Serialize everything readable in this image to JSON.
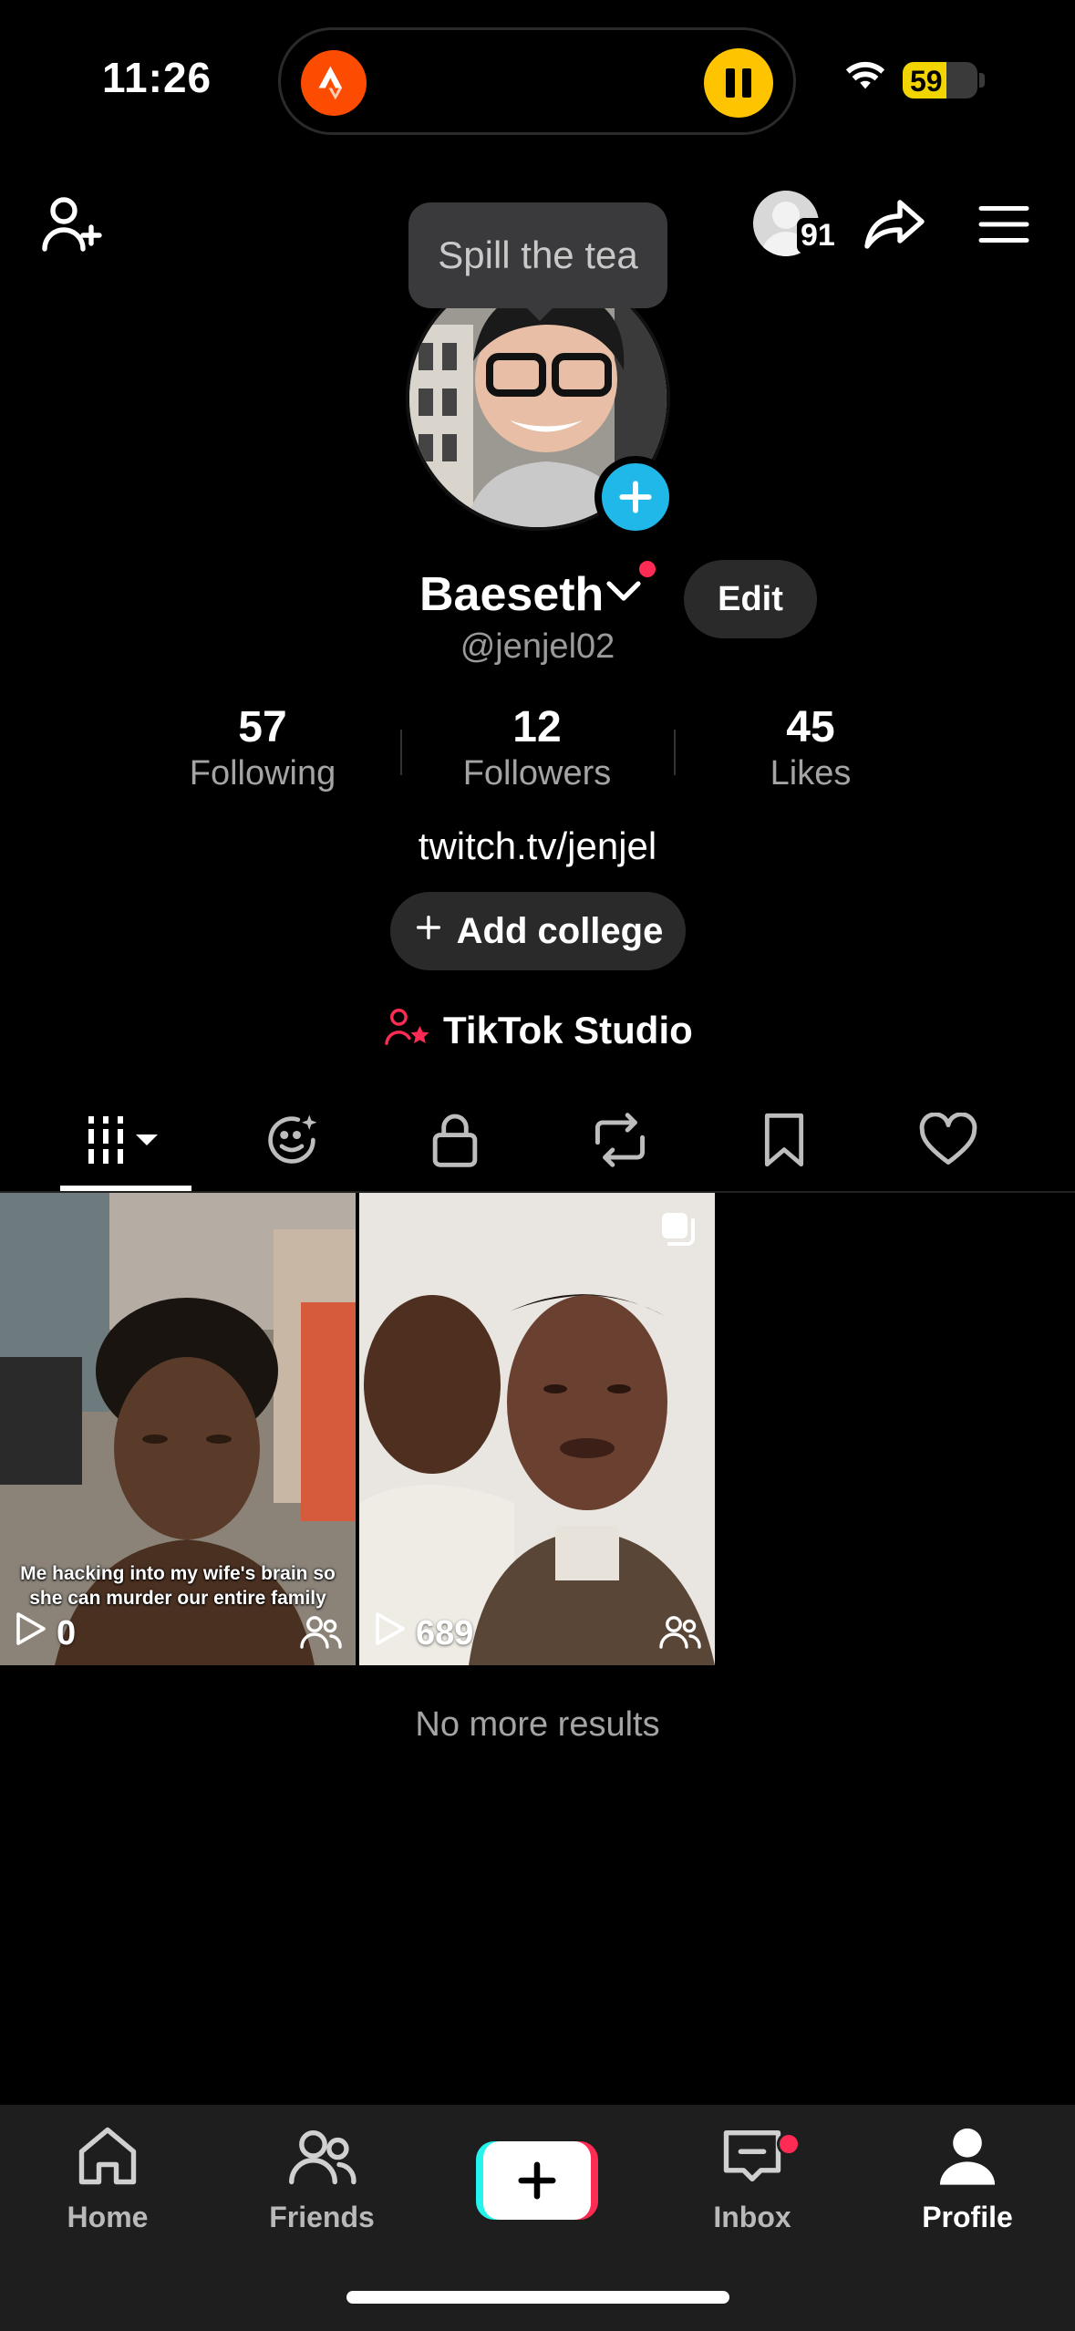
{
  "status_bar": {
    "time": "11:26",
    "battery": "59",
    "battery_level_percent": 59,
    "live_activity_app_icon": "strava-icon",
    "live_activity_control_icon": "pause-icon"
  },
  "header": {
    "add_friend_icon": "person-add-icon",
    "visitors_count": "91",
    "share_icon": "share-icon",
    "menu_icon": "hamburger-menu-icon",
    "tooltip": "Spill the tea"
  },
  "profile": {
    "username": "Baeseth",
    "handle": "@jenjel02",
    "edit_label": "Edit",
    "stats": [
      {
        "value": "57",
        "label": "Following"
      },
      {
        "value": "12",
        "label": "Followers"
      },
      {
        "value": "45",
        "label": "Likes"
      }
    ],
    "bio_link": "twitch.tv/jenjel",
    "add_college_label": "Add college",
    "studio_label": "TikTok Studio"
  },
  "tabs": [
    {
      "name": "videos",
      "icon": "grid-icon",
      "active": true
    },
    {
      "name": "ai-self",
      "icon": "smiley-sparkle-icon"
    },
    {
      "name": "private",
      "icon": "lock-icon"
    },
    {
      "name": "reposts",
      "icon": "repost-icon"
    },
    {
      "name": "favorites",
      "icon": "bookmark-icon"
    },
    {
      "name": "liked",
      "icon": "heart-icon"
    }
  ],
  "videos": [
    {
      "views": "0",
      "caption": "Me hacking into my wife's brain so she can murder our entire family"
    },
    {
      "views": "689",
      "caption": ""
    }
  ],
  "no_more_results": "No more results",
  "bottom_nav": {
    "home": "Home",
    "friends": "Friends",
    "inbox": "Inbox",
    "profile": "Profile"
  },
  "colors": {
    "accent_red": "#fe2c55",
    "accent_cyan": "#25f4ee",
    "avatar_add_blue": "#20b8e8",
    "battery_yellow": "#f2d400",
    "strava_orange": "#fc4c02"
  }
}
